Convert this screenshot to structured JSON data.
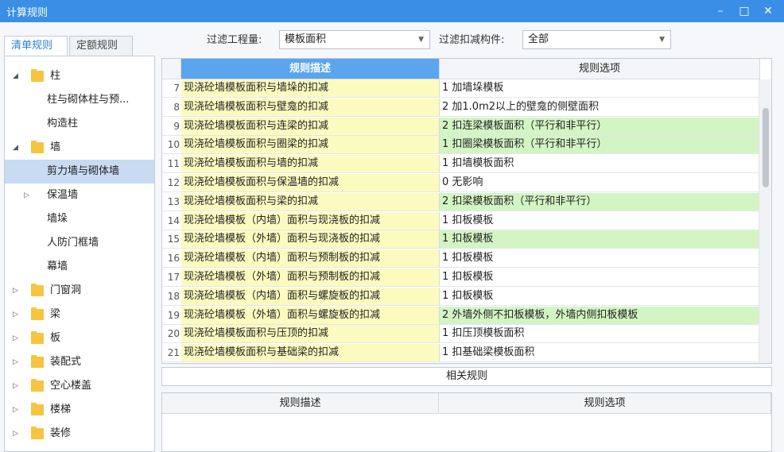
{
  "window": {
    "title": "计算规则",
    "minimize": "–",
    "maximize": "□",
    "close": "✕"
  },
  "tabs": [
    {
      "label": "清单规则",
      "active": true
    },
    {
      "label": "定额规则",
      "active": false
    }
  ],
  "filters": {
    "quantity_label": "过滤工程量:",
    "quantity_value": "模板面积",
    "deduct_label": "过滤扣减构件:",
    "deduct_value": "全部"
  },
  "tree": [
    {
      "label": "柱",
      "level": 0,
      "expander": "◢",
      "folder": true
    },
    {
      "label": "柱与砌体柱与预...",
      "level": 1,
      "expander": "",
      "folder": false
    },
    {
      "label": "构造柱",
      "level": 1,
      "expander": "",
      "folder": false
    },
    {
      "label": "墙",
      "level": 0,
      "expander": "◢",
      "folder": true
    },
    {
      "label": "剪力墙与砌体墙",
      "level": 1,
      "expander": "",
      "folder": false,
      "selected": true
    },
    {
      "label": "保温墙",
      "level": 1,
      "expander": "▷",
      "folder": false
    },
    {
      "label": "墙垛",
      "level": 1,
      "expander": "",
      "folder": false
    },
    {
      "label": "人防门框墙",
      "level": 1,
      "expander": "",
      "folder": false
    },
    {
      "label": "幕墙",
      "level": 1,
      "expander": "",
      "folder": false
    },
    {
      "label": "门窗洞",
      "level": 0,
      "expander": "▷",
      "folder": true
    },
    {
      "label": "梁",
      "level": 0,
      "expander": "▷",
      "folder": true
    },
    {
      "label": "板",
      "level": 0,
      "expander": "▷",
      "folder": true
    },
    {
      "label": "装配式",
      "level": 0,
      "expander": "▷",
      "folder": true
    },
    {
      "label": "空心楼盖",
      "level": 0,
      "expander": "▷",
      "folder": true
    },
    {
      "label": "楼梯",
      "level": 0,
      "expander": "▷",
      "folder": true
    },
    {
      "label": "装修",
      "level": 0,
      "expander": "▷",
      "folder": true
    }
  ],
  "grid": {
    "col_desc": "规则描述",
    "col_option": "规则选项",
    "rows": [
      {
        "num": "7",
        "desc": "现浇砼墙模板面积与墙垛的扣减",
        "option": "1  加墙垛模板",
        "changed": false
      },
      {
        "num": "8",
        "desc": "现浇砼墙模板面积与壁龛的扣减",
        "option": "2  加1.0m2以上的壁龛的侧壁面积",
        "changed": false
      },
      {
        "num": "9",
        "desc": "现浇砼墙模板面积与连梁的扣减",
        "option": "2 扣连梁模板面积（平行和非平行）",
        "changed": true
      },
      {
        "num": "10",
        "desc": "现浇砼墙模板面积与圈梁的扣减",
        "option": "1  扣圈梁模板面积（平行和非平行）",
        "changed": true
      },
      {
        "num": "11",
        "desc": "现浇砼墙模板面积与墙的扣减",
        "option": "1  扣墙模板面积",
        "changed": false
      },
      {
        "num": "12",
        "desc": "现浇砼墙模板面积与保温墙的扣减",
        "option": "0  无影响",
        "changed": false
      },
      {
        "num": "13",
        "desc": "现浇砼墙模板面积与梁的扣减",
        "option": "2  扣梁模板面积（平行和非平行）",
        "changed": true
      },
      {
        "num": "14",
        "desc": "现浇砼墙模板（内墙）面积与现浇板的扣减",
        "option": "1  扣板模板",
        "changed": false
      },
      {
        "num": "15",
        "desc": "现浇砼墙模板（外墙）面积与现浇板的扣减",
        "option": "1  扣板模板",
        "changed": true
      },
      {
        "num": "16",
        "desc": "现浇砼墙模板（内墙）面积与预制板的扣减",
        "option": "1  扣板模板",
        "changed": false
      },
      {
        "num": "17",
        "desc": "现浇砼墙模板（外墙）面积与预制板的扣减",
        "option": "1  扣板模板",
        "changed": false
      },
      {
        "num": "18",
        "desc": "现浇砼墙模板（内墙）面积与螺旋板的扣减",
        "option": "1  扣板模板",
        "changed": false
      },
      {
        "num": "19",
        "desc": "现浇砼墙模板（外墙）面积与螺旋板的扣减",
        "option": "2  外墙外侧不扣板模板，外墙内侧扣板模板",
        "changed": true
      },
      {
        "num": "20",
        "desc": "现浇砼墙模板面积与压顶的扣减",
        "option": "1  扣压顶模板面积",
        "changed": false
      },
      {
        "num": "21",
        "desc": "现浇砼墙模板面积与基础梁的扣减",
        "option": "1  扣基础梁模板面积",
        "changed": false
      }
    ]
  },
  "related": {
    "title": "相关规则",
    "col_desc": "规则描述",
    "col_option": "规则选项"
  },
  "colors": {
    "titlebar": "#3a8ee6",
    "header_desc": "#5aa5ee",
    "desc_bg": "#fbfbc0",
    "changed_bg": "#d3f5c4",
    "selected_tree": "#c7dcf3"
  }
}
